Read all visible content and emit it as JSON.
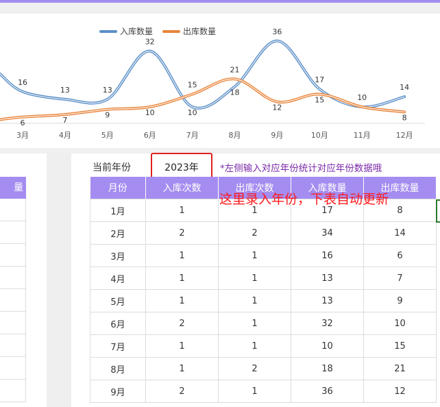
{
  "legend": [
    {
      "name": "入库数量",
      "color": "#5b8fc7"
    },
    {
      "name": "出库数量",
      "color": "#e8843a"
    }
  ],
  "chart_data": {
    "type": "line",
    "categories": [
      "3月",
      "4月",
      "5月",
      "6月",
      "7月",
      "8月",
      "9月",
      "10月",
      "11月",
      "12月"
    ],
    "series": [
      {
        "name": "入库数量",
        "values": [
          16,
          13,
          13,
          32,
          10,
          18,
          36,
          17,
          10,
          14
        ]
      },
      {
        "name": "出库数量",
        "values": [
          6,
          7,
          9,
          10,
          15,
          21,
          12,
          15,
          10,
          8
        ]
      }
    ],
    "data_labels": [
      {
        "series": "入库数量",
        "category": "3月",
        "text": "16"
      },
      {
        "series": "出库数量",
        "category": "3月",
        "text": "6"
      },
      {
        "series": "入库数量",
        "category": "4月",
        "text": "13"
      },
      {
        "series": "出库数量",
        "category": "4月",
        "text": "7"
      },
      {
        "series": "入库数量",
        "category": "5月",
        "text": "13"
      },
      {
        "series": "出库数量",
        "category": "5月",
        "text": "9"
      },
      {
        "series": "入库数量",
        "category": "6月",
        "text": "32"
      },
      {
        "series": "出库数量",
        "category": "6月",
        "text": "10"
      },
      {
        "series": "出库数量",
        "category": "7月",
        "text": "15"
      },
      {
        "series": "入库数量",
        "category": "7月",
        "text": "10"
      },
      {
        "series": "出库数量",
        "category": "8月",
        "text": "21"
      },
      {
        "series": "入库数量",
        "category": "8月",
        "text": "18"
      },
      {
        "series": "入库数量",
        "category": "9月",
        "text": "36"
      },
      {
        "series": "出库数量",
        "category": "9月",
        "text": "12"
      },
      {
        "series": "入库数量",
        "category": "10月",
        "text": "17"
      },
      {
        "series": "出库数量",
        "category": "10月",
        "text": "15"
      },
      {
        "series": "入库数量",
        "category": "11月",
        "text": "10"
      },
      {
        "series": "出库数量",
        "category": "12月",
        "text": "8"
      },
      {
        "series": "入库数量",
        "category": "12月",
        "text": "14"
      }
    ]
  },
  "left_table": {
    "header": "量"
  },
  "year_label": "当前年份",
  "year_value": "2023年",
  "hint": "*左侧输入对应年份统计对应年份数据哦",
  "annotation": "这里录入年份，下表自动更新",
  "table": {
    "headers": [
      "月份",
      "入库次数",
      "出库次数",
      "入库数量",
      "出库数量"
    ],
    "rows": [
      [
        "1月",
        "1",
        "1",
        "17",
        "8"
      ],
      [
        "2月",
        "2",
        "2",
        "34",
        "14"
      ],
      [
        "3月",
        "1",
        "1",
        "16",
        "6"
      ],
      [
        "4月",
        "1",
        "1",
        "13",
        "7"
      ],
      [
        "5月",
        "1",
        "1",
        "13",
        "9"
      ],
      [
        "6月",
        "2",
        "1",
        "32",
        "10"
      ],
      [
        "7月",
        "1",
        "1",
        "10",
        "15"
      ],
      [
        "8月",
        "1",
        "2",
        "18",
        "21"
      ],
      [
        "9月",
        "2",
        "1",
        "36",
        "12"
      ]
    ]
  }
}
